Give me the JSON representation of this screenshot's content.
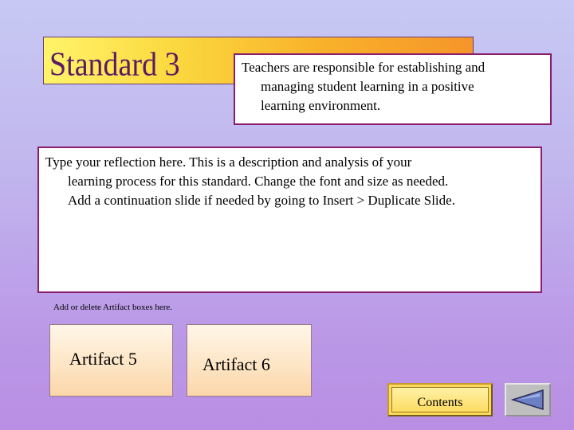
{
  "slide": {
    "title": "Standard 3",
    "standard_line1": "Teachers are responsible for establishing and",
    "standard_line2": "managing student learning in a positive",
    "standard_line3": "learning environment.",
    "reflection_line1": "Type your reflection here.  This is a description and analysis of your",
    "reflection_line2": "learning process for this standard.  Change the font and size as needed.",
    "reflection_line3": "Add a continuation slide if needed by going to Insert > Duplicate Slide.",
    "hint": "Add or delete Artifact boxes here.",
    "artifact5": "Artifact 5",
    "artifact6": "Artifact 6",
    "contents": "Contents",
    "back_icon": "triangle-left-icon"
  },
  "colors": {
    "title_text": "#5a1a66",
    "box_border": "#8a1e6e",
    "title_gradient_start": "#fff46a",
    "title_gradient_end": "#f6952a",
    "contents_bg": "#fcdc62",
    "back_arrow": "#6b7fc4"
  }
}
